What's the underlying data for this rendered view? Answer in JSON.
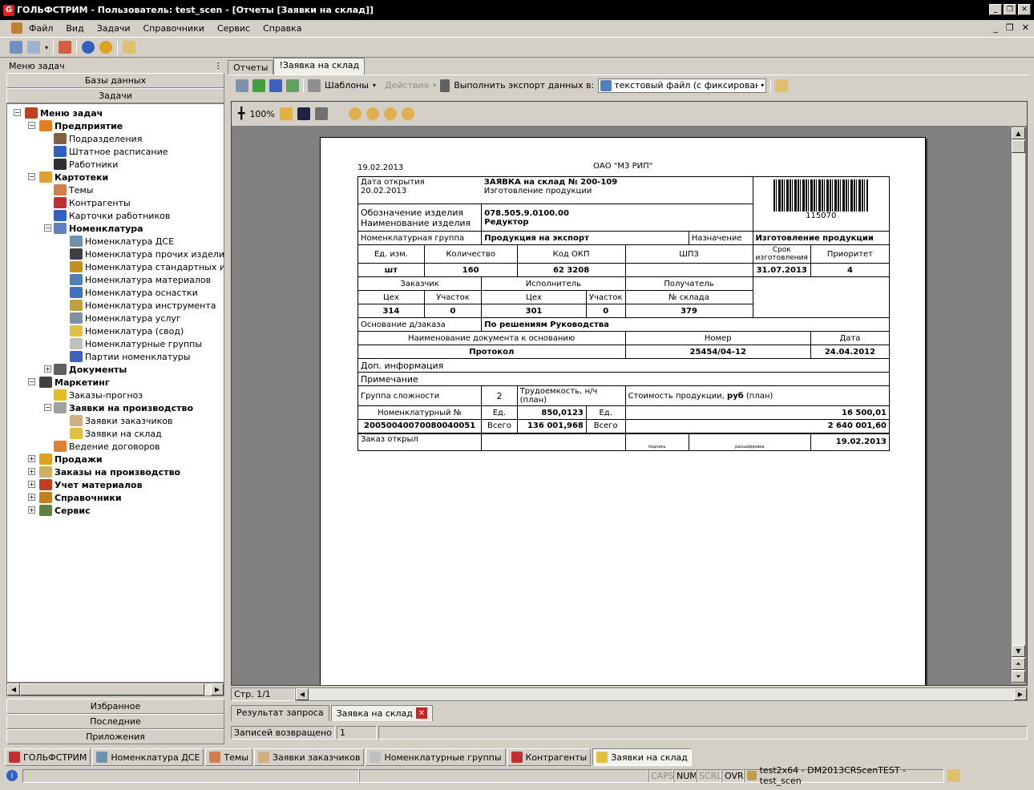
{
  "window": {
    "title": "ГОЛЬФСТРИМ - Пользователь: test_scen - [Отчеты  [Заявки на склад]]",
    "min": "_",
    "max": "❐",
    "close": "✕"
  },
  "menu": [
    "Файл",
    "Вид",
    "Задачи",
    "Справочники",
    "Сервис",
    "Справка"
  ],
  "left_panel": {
    "header": "Меню задач",
    "pin": "ⵗ",
    "top_bars": [
      "Базы данных",
      "Задачи"
    ],
    "bottom_bars": [
      "Избранное",
      "Последние",
      "Приложения"
    ],
    "tree": [
      {
        "label": "Меню задач",
        "bold": true,
        "level": 0,
        "exp": "−",
        "color": "#c04020"
      },
      {
        "label": "Предприятие",
        "bold": true,
        "level": 1,
        "exp": "−",
        "color": "#e08020"
      },
      {
        "label": "Подразделения",
        "bold": false,
        "level": 2,
        "color": "#806040"
      },
      {
        "label": "Штатное расписание",
        "bold": false,
        "level": 2,
        "color": "#3060c0"
      },
      {
        "label": "Работники",
        "bold": false,
        "level": 2,
        "color": "#303030"
      },
      {
        "label": "Картотеки",
        "bold": true,
        "level": 1,
        "exp": "−",
        "color": "#e0a030"
      },
      {
        "label": "Темы",
        "bold": false,
        "level": 2,
        "color": "#d08050"
      },
      {
        "label": "Контрагенты",
        "bold": false,
        "level": 2,
        "color": "#c03030"
      },
      {
        "label": "Карточки работников",
        "bold": false,
        "level": 2,
        "color": "#3060c0"
      },
      {
        "label": "Номенклатура",
        "bold": true,
        "level": 2,
        "exp": "−",
        "color": "#6080c0"
      },
      {
        "label": "Номенклатура ДСЕ",
        "bold": false,
        "level": 3,
        "color": "#7090b0"
      },
      {
        "label": "Номенклатура прочих изделий",
        "bold": false,
        "level": 3,
        "color": "#404040"
      },
      {
        "label": "Номенклатура стандартных изде",
        "bold": false,
        "level": 3,
        "color": "#c09020"
      },
      {
        "label": "Номенклатура материалов",
        "bold": false,
        "level": 3,
        "color": "#5080b0"
      },
      {
        "label": "Номенклатура оснастки",
        "bold": false,
        "level": 3,
        "color": "#4070c0"
      },
      {
        "label": "Номенклатура инструмента",
        "bold": false,
        "level": 3,
        "color": "#c0a040"
      },
      {
        "label": "Номенклатура услуг",
        "bold": false,
        "level": 3,
        "color": "#8090a0"
      },
      {
        "label": "Номенклатура (свод)",
        "bold": false,
        "level": 3,
        "color": "#e0c040"
      },
      {
        "label": "Номенклатурные группы",
        "bold": false,
        "level": 3,
        "color": "#c0c0c0"
      },
      {
        "label": "Партии номенклатуры",
        "bold": false,
        "level": 3,
        "color": "#4060c0"
      },
      {
        "label": "Документы",
        "bold": true,
        "level": 2,
        "exp": "+",
        "color": "#606060"
      },
      {
        "label": "Маркетинг",
        "bold": true,
        "level": 1,
        "exp": "−",
        "color": "#404040"
      },
      {
        "label": "Заказы-прогноз",
        "bold": false,
        "level": 2,
        "color": "#e0c020"
      },
      {
        "label": "Заявки на производство",
        "bold": true,
        "level": 2,
        "exp": "−",
        "color": "#a0a0a0"
      },
      {
        "label": "Заявки заказчиков",
        "bold": false,
        "level": 3,
        "color": "#d0b080"
      },
      {
        "label": "Заявки на склад",
        "bold": false,
        "level": 3,
        "color": "#e0c040"
      },
      {
        "label": "Ведение договоров",
        "bold": false,
        "level": 2,
        "color": "#e08030"
      },
      {
        "label": "Продажи",
        "bold": true,
        "level": 1,
        "exp": "+",
        "color": "#e0a020"
      },
      {
        "label": "Заказы на производство",
        "bold": true,
        "level": 1,
        "exp": "+",
        "color": "#d0b060"
      },
      {
        "label": "Учет материалов",
        "bold": true,
        "level": 1,
        "exp": "+",
        "color": "#c04020"
      },
      {
        "label": "Справочники",
        "bold": true,
        "level": 1,
        "exp": "+",
        "color": "#c08020"
      },
      {
        "label": "Сервис",
        "bold": true,
        "level": 1,
        "exp": "+",
        "color": "#608040"
      }
    ]
  },
  "tabs": [
    "Отчеты",
    "!Заявка на склад"
  ],
  "toolbar2": {
    "templates": "Шаблоны",
    "actions": "Действия",
    "export_label": "Выполнить экспорт данных в:",
    "export_value": "текстовый файл (с фиксированным"
  },
  "report_toolbar": {
    "zoom": "100%"
  },
  "report": {
    "date": "19.02.2013",
    "org": "ОАО \"МЗ РИП\"",
    "open_date_label": "Дата открытия",
    "open_date": "20.02.2013",
    "title": "ЗАЯВКА на склад  № 200-109",
    "subtitle": "Изготовление продукции",
    "barcode_num": "115070",
    "designation_label": "Обозначение изделия",
    "designation": "078.505.9.0100.00",
    "name_label": "Наименование изделия",
    "name": "Редуктор",
    "group_label": "Номенклатурная группа",
    "group": "Продукция на экспорт",
    "purpose_label": "Назначение",
    "purpose": "Изготовление продукции",
    "h_unit": "Ед. изм.",
    "h_qty": "Количество",
    "h_okp": "Код ОКП",
    "h_shpz": "ШПЗ",
    "h_term": "Срок изготовления",
    "h_prio": "Приоритет",
    "unit": "шт",
    "qty": "160",
    "okp": "62 3208",
    "term": "31.07.2013",
    "prio": "4",
    "h_customer": "Заказчик",
    "h_executor": "Исполнитель",
    "h_receiver": "Получатель",
    "h_shop": "Цех",
    "h_area": "Участок",
    "h_warehouse": "№ склада",
    "c_shop": "314",
    "c_area": "0",
    "e_shop": "301",
    "e_area": "0",
    "warehouse": "379",
    "basis_label": "Основание д/заказа",
    "basis": "По решениям Руководства",
    "h_docname": "Наименование документа к основанию",
    "h_number": "Номер",
    "h_date": "Дата",
    "docname": "Протокол",
    "docnum": "25454/04-12",
    "docdate": "24.04.2012",
    "extra_label": "Доп. информация",
    "note_label": "Примечание",
    "complexity_label": "Группа сложности",
    "complexity": "2",
    "labor_label": "Трудоемкость, н/ч",
    "plan1": "(план)",
    "cost_label": "Стоимость продукции,",
    "cost_unit": "руб",
    "plan2": "(план)",
    "nomnum_label": "Номенклатурный №",
    "unit_short": "Ед.",
    "labor_unit_val": "850,0123",
    "cost_unit_val": "16 500,01",
    "nomnum": "20050040070080040051",
    "total_label": "Всего",
    "labor_total": "136 001,968",
    "cost_total": "2 640 001,60",
    "opened_label": "Заказ открыл",
    "sign": "подпись",
    "decode": "расшифровка",
    "opened_date": "19.02.2013"
  },
  "page_indicator": "Стр. 1/1",
  "bottom_tabs": [
    "Результат запроса",
    "Заявка на склад"
  ],
  "records": {
    "label": "Записей возвращено",
    "value": "1"
  },
  "taskbar": [
    {
      "label": "ГОЛЬФСТРИМ",
      "color": "#c03030"
    },
    {
      "label": "Номенклатура ДСЕ",
      "color": "#7090b0"
    },
    {
      "label": "Темы",
      "color": "#d08050"
    },
    {
      "label": "Заявки заказчиков",
      "color": "#d0b080"
    },
    {
      "label": "Номенклатурные группы",
      "color": "#c0c0c0"
    },
    {
      "label": "Контрагенты",
      "color": "#c03030"
    },
    {
      "label": "Заявки на склад",
      "color": "#e0c040"
    }
  ],
  "statusbar": {
    "caps": "CAPS",
    "num": "NUM",
    "scrl": "SCRL",
    "ovr": "OVR",
    "conn": "test2x64 - DM2013CRScenTEST - test_scen"
  }
}
